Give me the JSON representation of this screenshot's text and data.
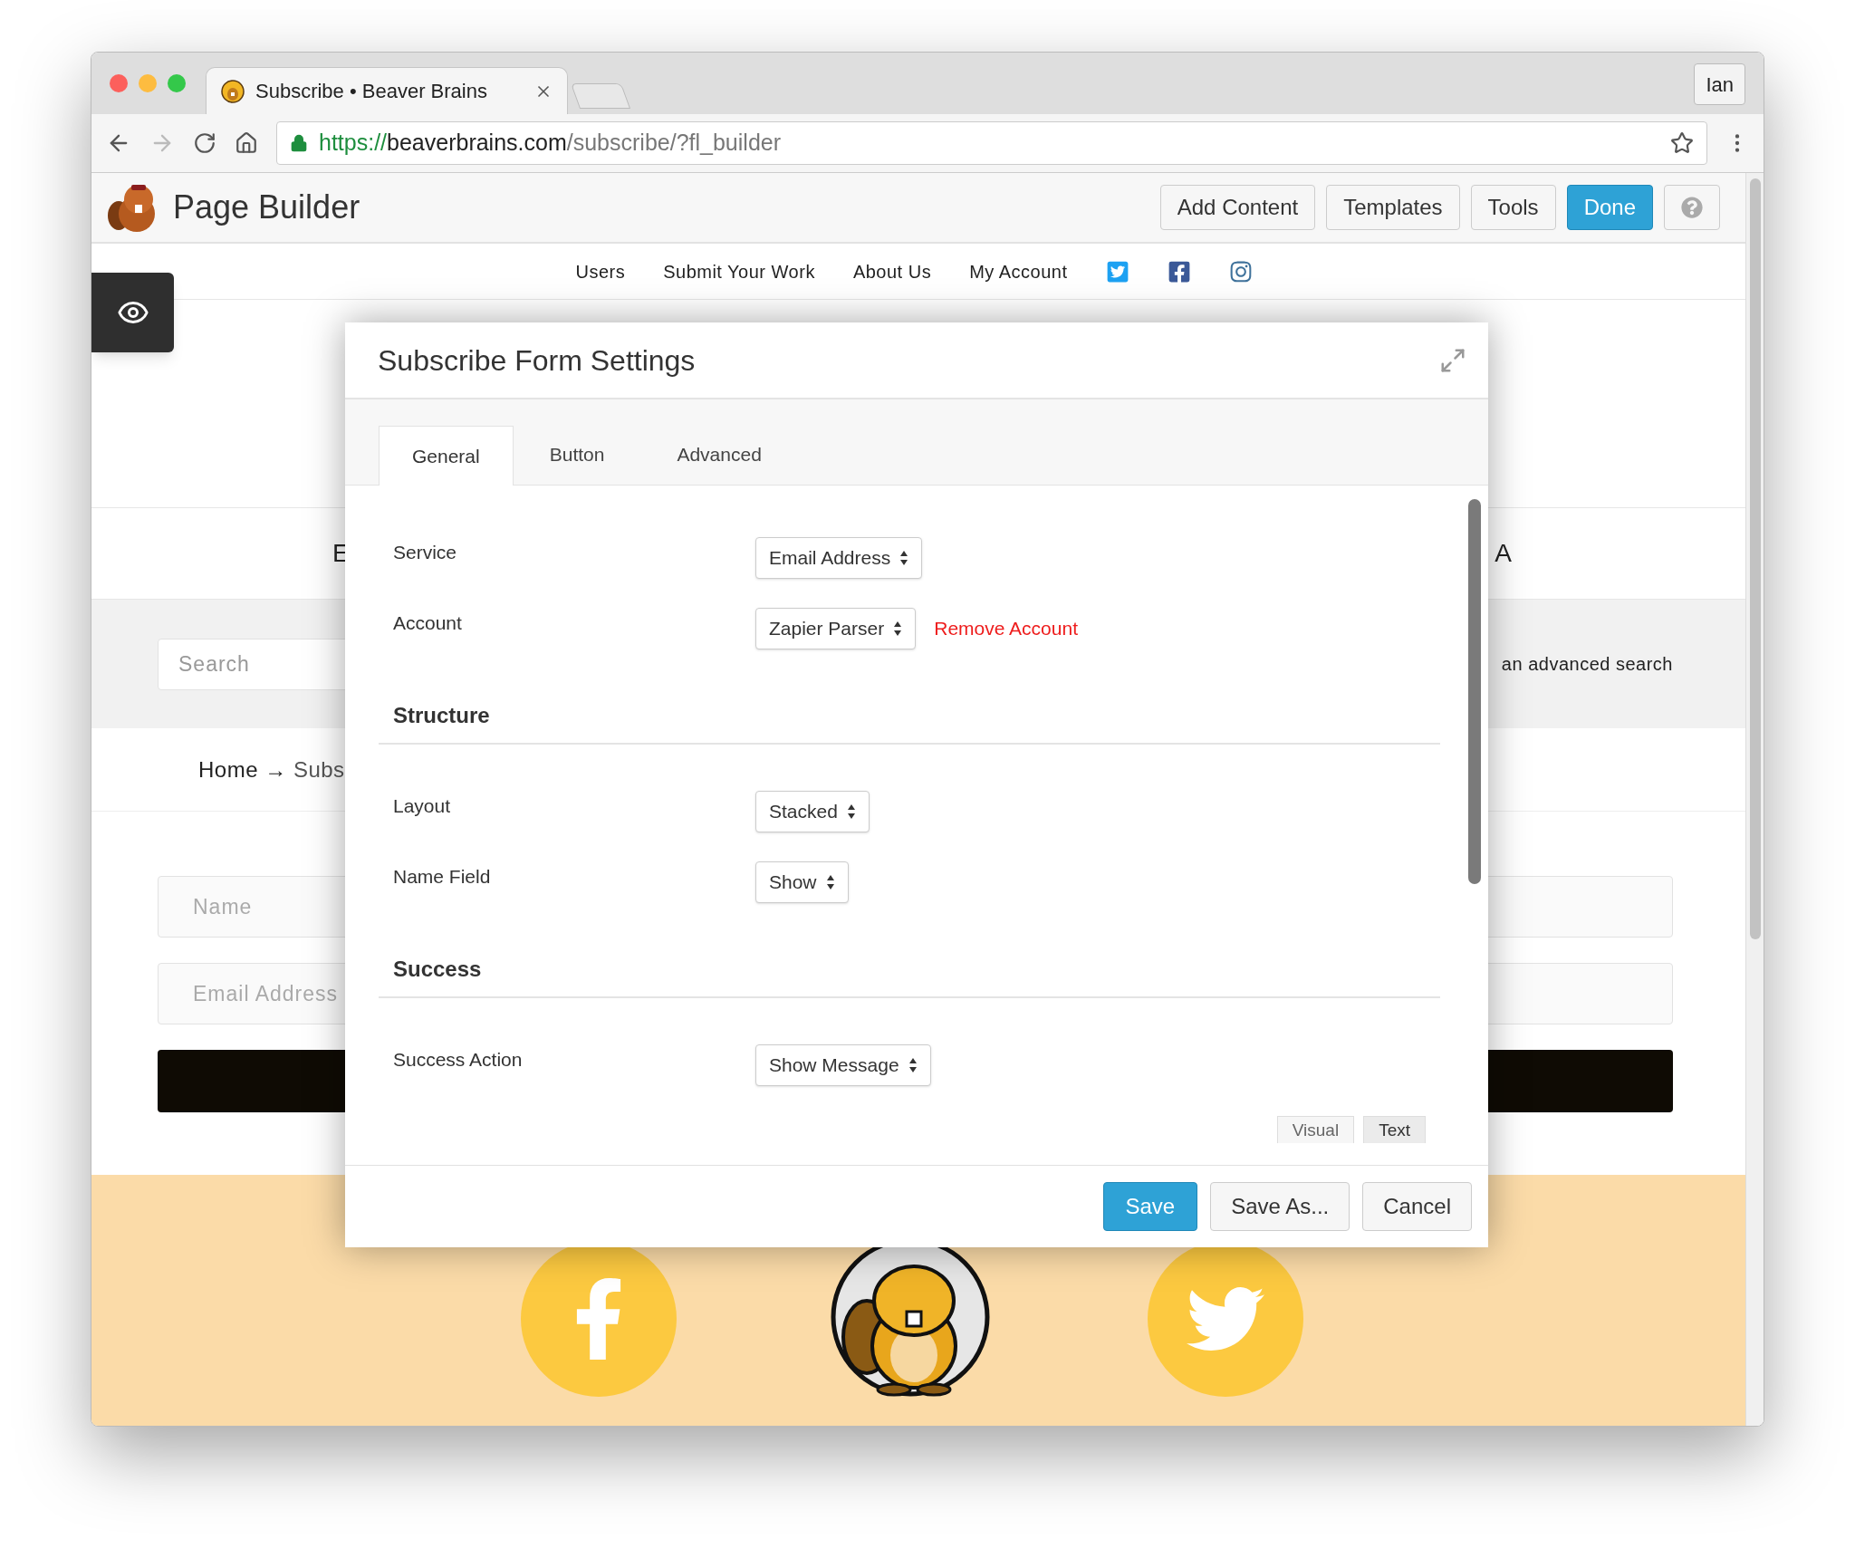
{
  "browser": {
    "tab_title": "Subscribe • Beaver Brains",
    "profile": "Ian",
    "url": {
      "scheme": "https://",
      "host": "beaverbrains.com",
      "path": "/subscribe/?fl_builder"
    }
  },
  "builder_bar": {
    "title": "Page Builder",
    "buttons": [
      {
        "label": "Add Content",
        "kind": "default"
      },
      {
        "label": "Templates",
        "kind": "default"
      },
      {
        "label": "Tools",
        "kind": "default"
      },
      {
        "label": "Done",
        "kind": "primary"
      }
    ]
  },
  "site_nav": {
    "links": [
      "Users",
      "Submit Your Work",
      "About Us",
      "My Account"
    ]
  },
  "page": {
    "heading_fragments": [
      "E",
      "A"
    ],
    "search": {
      "placeholder": "Search"
    },
    "search_note": "an advanced search",
    "breadcrumb": {
      "home": "Home",
      "arrow": "→",
      "current": "Subs"
    },
    "form": {
      "fields": [
        {
          "placeholder": "Name"
        },
        {
          "placeholder": "Email Address"
        }
      ]
    }
  },
  "modal": {
    "title": "Subscribe Form Settings",
    "tabs": [
      {
        "label": "General",
        "selected": true
      },
      {
        "label": "Button",
        "selected": false
      },
      {
        "label": "Advanced",
        "selected": false
      }
    ],
    "rows": [
      {
        "kind": "select",
        "label": "Service",
        "value": "Email Address"
      },
      {
        "kind": "select",
        "label": "Account",
        "value": "Zapier Parser",
        "link": "Remove Account"
      },
      {
        "kind": "heading",
        "label": "Structure"
      },
      {
        "kind": "select",
        "label": "Layout",
        "value": "Stacked"
      },
      {
        "kind": "select",
        "label": "Name Field",
        "value": "Show"
      },
      {
        "kind": "heading",
        "label": "Success"
      },
      {
        "kind": "select",
        "label": "Success Action",
        "value": "Show Message"
      }
    ],
    "editor_tabs": [
      {
        "label": "Visual",
        "selected": false
      },
      {
        "label": "Text",
        "selected": true
      }
    ],
    "buttons": [
      {
        "label": "Save",
        "kind": "primary"
      },
      {
        "label": "Save As...",
        "kind": "default"
      },
      {
        "label": "Cancel",
        "kind": "default"
      }
    ]
  }
}
